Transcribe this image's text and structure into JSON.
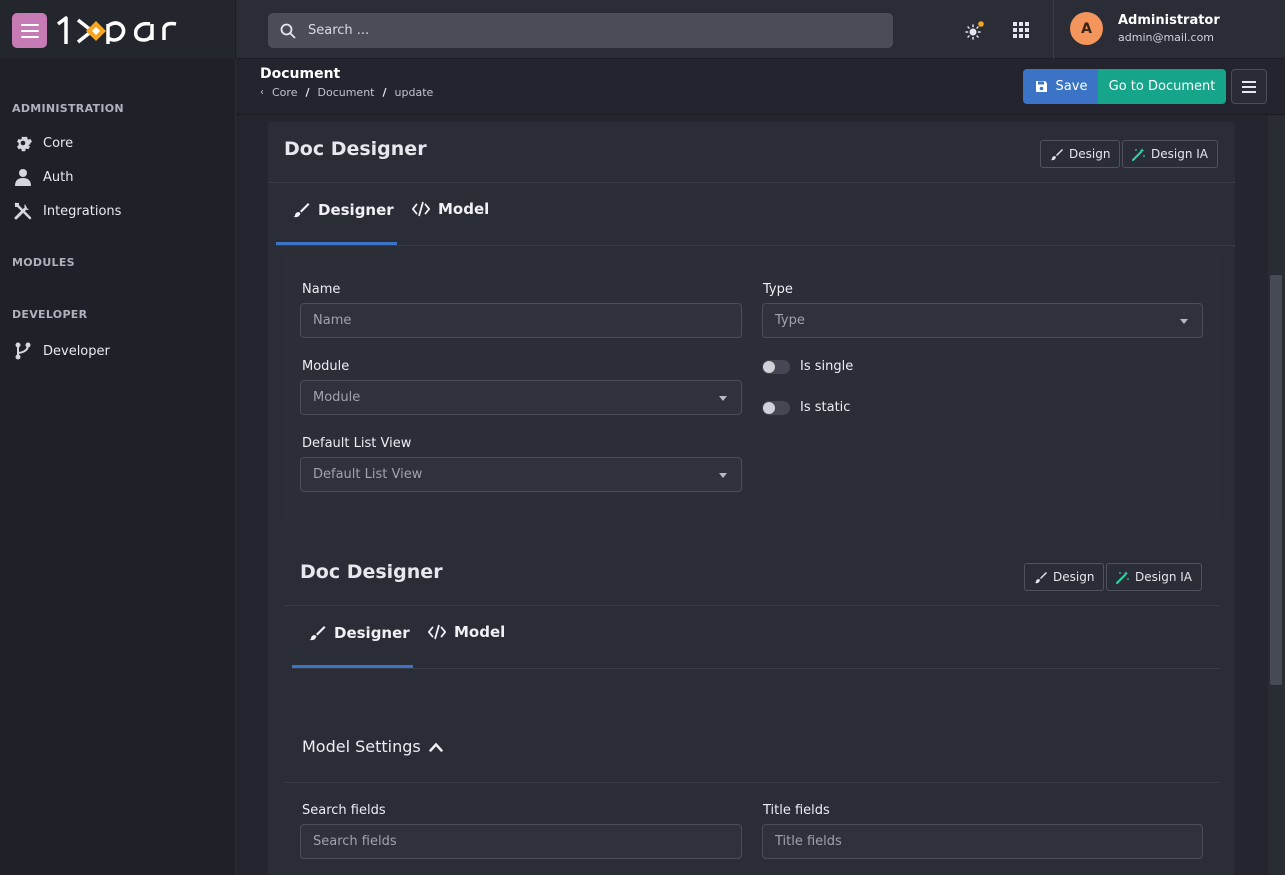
{
  "topbar": {
    "search_placeholder": "Search ...",
    "user": {
      "initial": "A",
      "name": "Administrator",
      "email": "admin@mail.com"
    }
  },
  "sidebar": {
    "sections": [
      {
        "title": "ADMINISTRATION",
        "items": [
          {
            "label": "Core",
            "icon": "gear-icon"
          },
          {
            "label": "Auth",
            "icon": "user-icon"
          },
          {
            "label": "Integrations",
            "icon": "tools-icon"
          }
        ]
      },
      {
        "title": "MODULES",
        "items": []
      },
      {
        "title": "DEVELOPER",
        "items": [
          {
            "label": "Developer",
            "icon": "branch-icon"
          }
        ]
      }
    ]
  },
  "header": {
    "title": "Document",
    "breadcrumb": [
      "Core",
      "Document",
      "update"
    ],
    "save_label": "Save",
    "goto_label": "Go to Document"
  },
  "designer": {
    "title": "Doc Designer",
    "design_label": "Design",
    "design_ia_label": "Design IA",
    "tabs": [
      "Designer",
      "Model"
    ]
  },
  "form": {
    "name": {
      "label": "Name",
      "placeholder": "Name"
    },
    "type": {
      "label": "Type",
      "placeholder": "Type"
    },
    "module": {
      "label": "Module",
      "placeholder": "Module"
    },
    "default_list_view": {
      "label": "Default List View",
      "placeholder": "Default List View"
    },
    "is_single": "Is single",
    "is_static": "Is static"
  },
  "designer2": {
    "title": "Doc Designer",
    "design_label": "Design",
    "design_ia_label": "Design IA",
    "tabs": [
      "Designer",
      "Model"
    ]
  },
  "model_settings": {
    "title": "Model Settings",
    "search_fields": {
      "label": "Search fields",
      "placeholder": "Search fields"
    },
    "title_fields": {
      "label": "Title fields",
      "placeholder": "Title fields"
    }
  },
  "colors": {
    "primary": "#3b74c6",
    "success": "#16a58a",
    "menu_button": "#c77bb5",
    "avatar": "#f4955b"
  }
}
